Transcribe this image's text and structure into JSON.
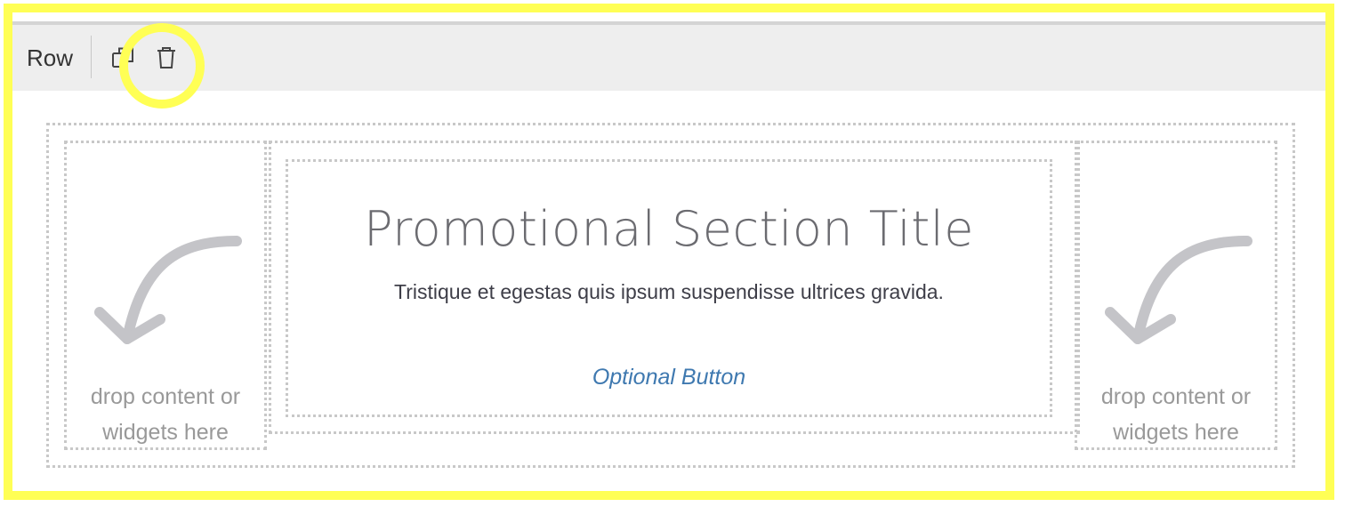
{
  "toolbar": {
    "row_label": "Row",
    "duplicate_icon": "duplicate-icon",
    "delete_icon": "trash-icon"
  },
  "columns": {
    "left": {
      "drop_line1": "drop content or",
      "drop_line2": "widgets here",
      "icon": "arrow-down-left-icon"
    },
    "right": {
      "drop_line1": "drop content or",
      "drop_line2": "widgets here",
      "icon": "arrow-down-left-icon"
    }
  },
  "promo": {
    "title": "Promotional Section Title",
    "subtitle": "Tristique et egestas quis ipsum suspendisse ultrices gravida.",
    "button_label": "Optional Button"
  },
  "colors": {
    "highlight": "#ffff55",
    "toolbar_bg": "#eeeeee",
    "link": "#3f79b0",
    "dotted_border": "#c8c8c8"
  }
}
